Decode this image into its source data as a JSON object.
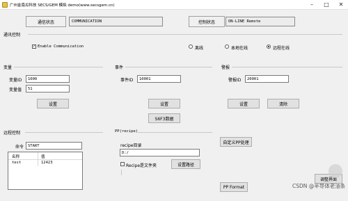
{
  "window": {
    "title": "广州金南瓜科技 SECS/GEM 模拟 demo(www.secsgem.cn)",
    "minimize": "–",
    "maximize": "□",
    "close": "✕"
  },
  "status": {
    "comm_label": "通信状态",
    "comm_value": "COMMUNICATION",
    "control_label": "控制状态",
    "control_value": "ON-LINE Remote"
  },
  "comm_control": {
    "title": "通讯控制",
    "enable_label": "Enable Communication",
    "enable_checked": true,
    "radios": [
      {
        "label": "离线",
        "selected": false
      },
      {
        "label": "本地在线",
        "selected": false
      },
      {
        "label": "远程在线",
        "selected": true
      }
    ]
  },
  "variable": {
    "title": "变量",
    "id_label": "变量ID",
    "id_value": "1000",
    "val_label": "变量值",
    "val_value": "51",
    "set_button": "设置"
  },
  "event": {
    "title": "事件",
    "id_label": "事件ID",
    "id_value": "10001",
    "set_button": "设置",
    "s6f3_button": "S6F3数据"
  },
  "alarm": {
    "title": "警报",
    "id_label": "警报ID",
    "id_value": "20001",
    "set_button": "设置",
    "clear_button": "清除"
  },
  "remote": {
    "title": "远程控制",
    "cmd_label": "命令",
    "cmd_value": "START",
    "columns": [
      "名称",
      "值"
    ],
    "rows": [
      {
        "name": "test",
        "value": "12423"
      }
    ]
  },
  "pp": {
    "title": "PP(recipe)",
    "dir_label": "recipe目录",
    "dir_value": "D:/",
    "is_folder_label": "Recipe是文件夹",
    "is_folder_checked": false,
    "set_path_button": "设置路径",
    "custom_button": "自定义PP处理",
    "format_button": "PP Format"
  },
  "misc": {
    "adjust_button": "调整界面"
  },
  "watermark": {
    "text": "CSDN @半导体老油条"
  }
}
